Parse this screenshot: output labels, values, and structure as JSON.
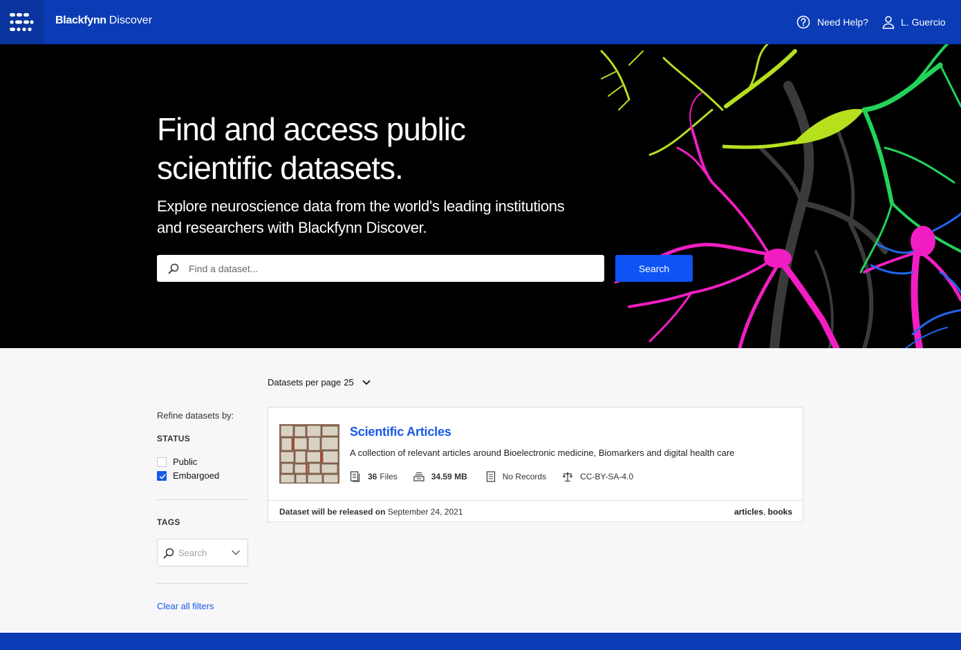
{
  "header": {
    "brand_bold": "Blackfynn",
    "brand_light": "Discover",
    "help_label": "Need Help?",
    "user_label": "L. Guercio",
    "logo_icon": "blackfynn-grid-logo",
    "help_icon": "question-circle-icon",
    "user_icon": "user-icon"
  },
  "hero": {
    "title_line1": "Find and access public",
    "title_line2": "scientific datasets.",
    "subtitle_line1": "Explore neuroscience data from the world's leading institutions",
    "subtitle_line2": "and researchers with Blackfynn Discover.",
    "search_placeholder": "Find a dataset...",
    "search_button": "Search"
  },
  "filters": {
    "refine_title": "Refine datasets by:",
    "status_heading": "STATUS",
    "status_options": [
      {
        "label": "Public",
        "checked": false
      },
      {
        "label": "Embargoed",
        "checked": true
      }
    ],
    "tags_heading": "TAGS",
    "tags_search_placeholder": "Search",
    "clear_all": "Clear all filters"
  },
  "results": {
    "per_page_label": "Datasets per page",
    "per_page_value": "25",
    "datasets": [
      {
        "title": "Scientific Articles",
        "description": "A collection of relevant articles around Bioelectronic medicine, Biomarkers and digital health care",
        "files_count": "36",
        "files_label": "Files",
        "size": "34.59 MB",
        "records": "No Records",
        "license": "CC-BY-SA-4.0",
        "release_label": "Dataset will be released on",
        "release_date": "September 24, 2021",
        "tag1": "articles",
        "tag_sep": ",",
        "tag2": "books"
      }
    ]
  },
  "colors": {
    "header_bg": "#0b3cb5",
    "accent": "#1559e8",
    "button": "#0d53f5"
  }
}
